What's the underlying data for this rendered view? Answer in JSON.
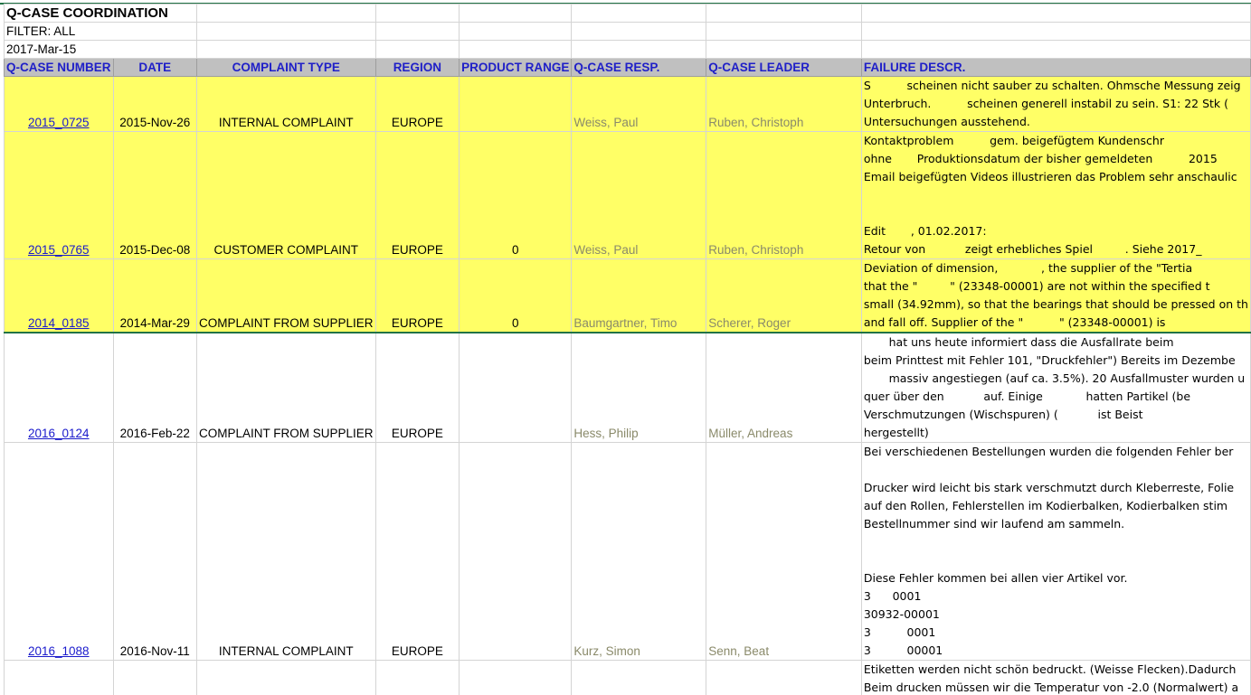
{
  "title": "Q-CASE COORDINATION",
  "filter": "FILTER: ALL",
  "date": "2017-Mar-15",
  "headers": [
    "Q-CASE NUMBER",
    "DATE",
    "COMPLAINT TYPE",
    "REGION",
    "PRODUCT RANGE",
    "Q-CASE RESP.",
    "Q-CASE LEADER",
    "FAILURE DESCR."
  ],
  "rows": [
    {
      "id": "2015_0725",
      "date": "2015-Nov-26",
      "type": "INTERNAL COMPLAINT",
      "region": "EUROPE",
      "range": "",
      "resp": "Weiss, Paul",
      "leader": "Ruben, Christoph",
      "descr": "S          scheinen nicht sauber zu schalten. Ohmsche Messung zeig\nUnterbruch.          scheinen generell instabil zu sein. S1: 22 Stk (\nUntersuchungen ausstehend."
    },
    {
      "id": "2015_0765",
      "date": "2015-Dec-08",
      "type": "CUSTOMER COMPLAINT",
      "region": "EUROPE",
      "range": "0",
      "resp": "Weiss, Paul",
      "leader": "Ruben, Christoph",
      "descr": "Kontaktproblem          gem. beigefügtem Kundenschr\nohne       Produktionsdatum der bisher gemeldeten          2015\nEmail beigefügten Videos illustrieren das Problem sehr anschaulic\n\n\nEdit       , 01.02.2017:\nRetour von           zeigt erhebliches Spiel         . Siehe 2017_"
    },
    {
      "id": "2014_0185",
      "date": "2014-Mar-29",
      "type": "COMPLAINT FROM SUPPLIER",
      "region": "EUROPE",
      "range": "0",
      "resp": "Baumgartner, Timo",
      "leader": "Scherer, Roger",
      "descr": "Deviation of dimension,            , the supplier of the \"Tertia\nthat the \"         \" (23348-00001) are not within the specified t\nsmall (34.92mm), so that the bearings that should be pressed on th\nand fall off. Supplier of the \"          \" (23348-00001) is"
    },
    {
      "id": "2016_0124",
      "date": "2016-Feb-22",
      "type": "COMPLAINT FROM SUPPLIER",
      "region": "EUROPE",
      "range": "",
      "resp": "Hess, Philip",
      "leader": "Müller, Andreas",
      "descr": "       hat uns heute informiert dass die Ausfallrate beim\nbeim Printtest mit Fehler 101, \"Druckfehler\") Bereits im Dezembe\n       massiv angestiegen (auf ca. 3.5%). 20 Ausfallmuster wurden u\nquer über den           auf. Einige            hatten Partikel (be\nVerschmutzungen (Wischspuren) (           ist Beist\nhergestellt)"
    },
    {
      "id": "2016_1088",
      "date": "2016-Nov-11",
      "type": "INTERNAL COMPLAINT",
      "region": "EUROPE",
      "range": "",
      "resp": "Kurz, Simon",
      "leader": "Senn, Beat",
      "descr": "Bei verschiedenen Bestellungen wurden die folgenden Fehler ber\n\nDrucker wird leicht bis stark verschmutzt durch Kleberreste, Folie\nauf den Rollen, Fehlerstellen im Kodierbalken, Kodierbalken stim\nBestellnummer sind wir laufend am sammeln.\n\n\nDiese Fehler kommen bei allen vier Artikel vor.\n3      0001\n30932-00001\n3          0001\n3          00001"
    },
    {
      "id": "",
      "date": "",
      "type": "",
      "region": "",
      "range": "",
      "resp": "",
      "leader": "",
      "descr": "Etiketten werden nicht schön bedruckt. (Weisse Flecken).Dadurch\nBeim drucken müssen wir die Temperatur von -2.0 (Normalwert) a"
    }
  ]
}
